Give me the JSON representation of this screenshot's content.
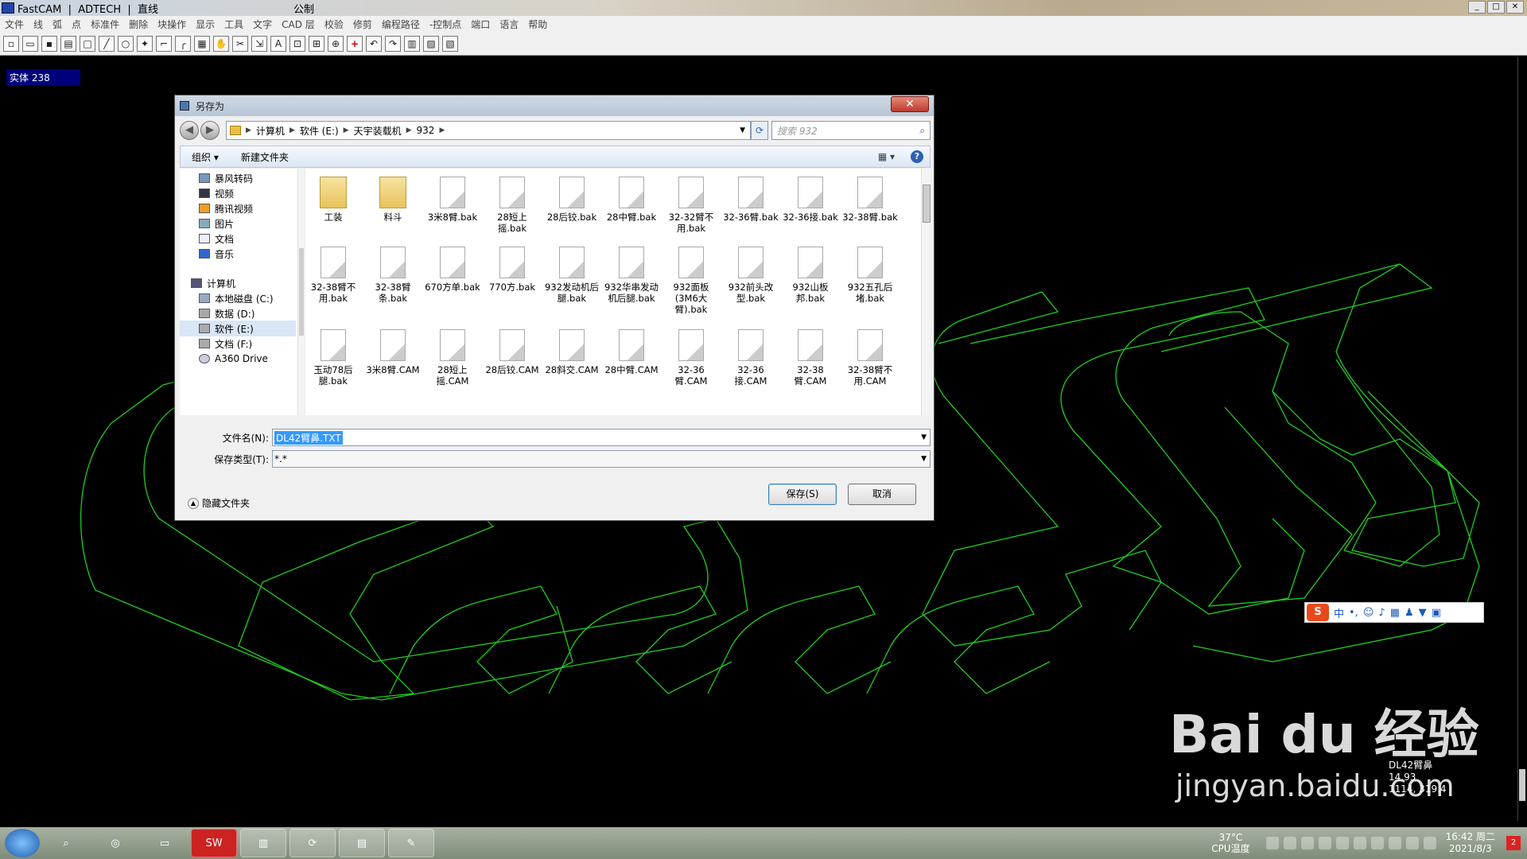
{
  "app": {
    "title": "FastCAM  |  ADTECH  |  直线",
    "unit": "公制"
  },
  "menu": [
    "文件",
    "线",
    "弧",
    "点",
    "标准件",
    "删除",
    "块操作",
    "显示",
    "工具",
    "文字",
    "CAD 层",
    "校验",
    "修剪",
    "编程路径",
    "-控制点",
    "端口",
    "语言",
    "帮助"
  ],
  "toolbar": {
    "icons": [
      "new-file-icon",
      "open-folder-icon",
      "save-icon",
      "print-icon",
      "rectangle-icon",
      "line-icon",
      "circle-icon",
      "point-icon",
      "chamfer-icon",
      "fillet-icon",
      "fill-icon",
      "hand-icon",
      "trim-icon",
      "export-icon",
      "text-icon",
      "zoom-window-icon",
      "zoom-all-icon",
      "zoom-icon",
      "add-icon",
      "undo-icon",
      "redo-icon",
      "path-icon",
      "chart-icon",
      "output-icon"
    ],
    "text_label": "A",
    "add_label": "+"
  },
  "canvas": {
    "entity_label": "实体  238",
    "line_color": "#22cc22"
  },
  "dialog": {
    "title": "另存为",
    "close_label": "✕",
    "breadcrumb": [
      "计算机",
      "软件 (E:)",
      "天宇装载机",
      "932"
    ],
    "search_placeholder": "搜索 932",
    "commands": {
      "organize": "组织 ▾",
      "new_folder": "新建文件夹"
    },
    "nav_items": [
      {
        "label": "暴风转码",
        "icon": "video-converter-icon"
      },
      {
        "label": "视频",
        "icon": "video-library-icon"
      },
      {
        "label": "腾讯视频",
        "icon": "tencent-video-icon"
      },
      {
        "label": "图片",
        "icon": "pictures-icon"
      },
      {
        "label": "文档",
        "icon": "documents-icon"
      },
      {
        "label": "音乐",
        "icon": "music-icon"
      },
      {
        "label": "计算机",
        "icon": "computer-icon"
      },
      {
        "label": "本地磁盘 (C:)",
        "icon": "drive-icon"
      },
      {
        "label": "数据 (D:)",
        "icon": "drive-icon"
      },
      {
        "label": "软件 (E:)",
        "icon": "drive-icon"
      },
      {
        "label": "文档 (F:)",
        "icon": "drive-icon"
      },
      {
        "label": "A360 Drive",
        "icon": "cloud-drive-icon"
      }
    ],
    "files_row1": [
      "工装",
      "料斗",
      "3米8臂.bak",
      "28短上摇.bak",
      "28后铰.bak",
      "28中臂.bak",
      "32-32臂不用.bak",
      "32-36臂.bak",
      "32-36接.bak",
      "32-38臂.bak"
    ],
    "files_row2": [
      "32-38臂不用.bak",
      "32-38臂条.bak",
      "670方单.bak",
      "770方.bak",
      "932发动机后腿.bak",
      "932华串发动机后腿.bak",
      "932面板(3M6大臂).bak",
      "932前头改型.bak",
      "932山板邦.bak",
      "932五孔后堵.bak"
    ],
    "files_row3": [
      "玉动78后腿.bak",
      "3米8臂.CAM",
      "28短上摇.CAM",
      "28后铰.CAM",
      "28斜交.CAM",
      "28中臂.CAM",
      "32-36臂.CAM",
      "32-36接.CAM",
      "32-38臂.CAM",
      "32-38臂不用.CAM"
    ],
    "filename_label": "文件名(N):",
    "filename_value": "DL42臂鼻.TXT",
    "filetype_label": "保存类型(T):",
    "filetype_value": "*.*",
    "save_label": "保存(S)",
    "cancel_label": "取消",
    "hide_folders_label": "隐藏文件夹"
  },
  "ime": {
    "logo": "S",
    "mode": "中"
  },
  "watermark": {
    "brand": "Bai du 经验",
    "url": "jingyan.baidu.com"
  },
  "readout": {
    "line1": "DL42臂鼻",
    "line2": "14.93",
    "line3": "1114, 319.4"
  },
  "taskbar": {
    "apps": [
      "search-icon",
      "browser-icon",
      "camera-icon",
      "solidworks-icon",
      "explorer-icon",
      "refresh-app-icon",
      "fastcam-icon",
      "paint-icon"
    ],
    "sw_label": "SW",
    "temp": "37°C",
    "temp_label": "CPU温度",
    "time": "16:42 周二",
    "date": "2021/8/3",
    "notify": "2"
  }
}
